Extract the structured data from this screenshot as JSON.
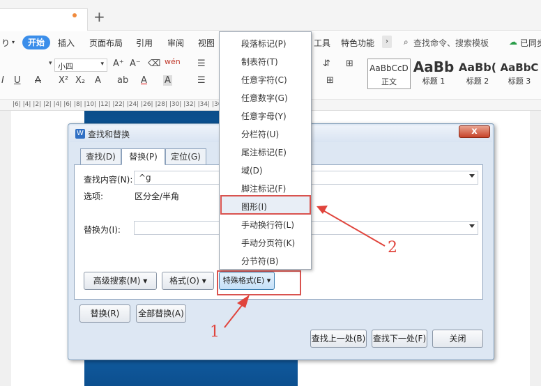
{
  "tab_bar": {
    "new_tab": "+"
  },
  "menu_bar": {
    "undo": "り",
    "items": [
      "开始",
      "插入",
      "页面布局",
      "引用",
      "审阅",
      "视图",
      "工具",
      "特色功能"
    ],
    "search": "查找命令、搜索模板",
    "sync": "已同步"
  },
  "ribbon": {
    "font_size": "小四",
    "styles": [
      {
        "preview": "AaBbCcD",
        "name": "正文"
      },
      {
        "preview": "AaBb",
        "name": "标题 1"
      },
      {
        "preview": "AaBb(",
        "name": "标题 2"
      },
      {
        "preview": "AaBbC",
        "name": "标题 3"
      }
    ]
  },
  "ruler": {
    "ticks": "|6|  |4|  |2|        |2|  |4|  |6|  |8|  |10|  |12|                             |22|  |24|  |26|  |28|  |30|  |32|  |34|  |36|  |38|  |40|"
  },
  "dialog": {
    "title": "查找和替换",
    "close": "x",
    "tabs": [
      "查找(D)",
      "替换(P)",
      "定位(G)"
    ],
    "find_label": "查找内容(N):",
    "find_value": "^g",
    "options_label": "选项:",
    "options_value": "区分全/半角",
    "replace_label": "替换为(I):",
    "advanced_search": "高级搜索(M) ▾",
    "format": "格式(O) ▾",
    "special_format": "特殊格式(E) ▾",
    "replace": "替换(R)",
    "replace_all": "全部替换(A)",
    "find_prev": "查找上一处(B)",
    "find_next": "查找下一处(F)",
    "close_btn": "关闭"
  },
  "special_menu": {
    "items": [
      "段落标记(P)",
      "制表符(T)",
      "任意字符(C)",
      "任意数字(G)",
      "任意字母(Y)",
      "分栏符(U)",
      "尾注标记(E)",
      "域(D)",
      "脚注标记(F)",
      "图形(I)",
      "手动换行符(L)",
      "手动分页符(K)",
      "分节符(B)"
    ],
    "highlighted": "图形(I)"
  },
  "annotations": {
    "label_1": "1",
    "label_2": "2",
    "color": "#e0443c"
  }
}
